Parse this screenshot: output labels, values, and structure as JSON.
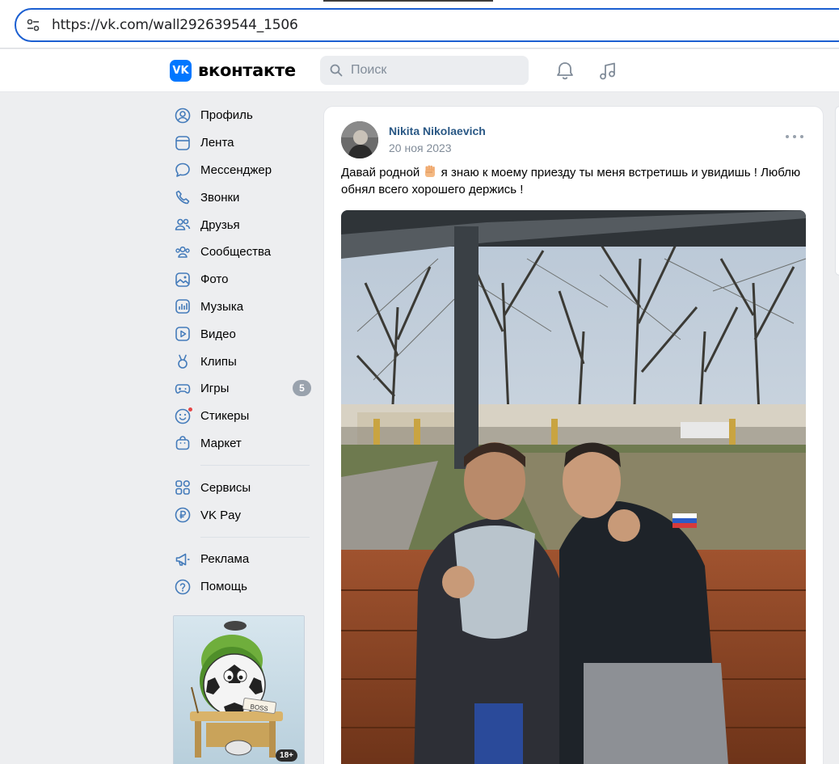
{
  "browser": {
    "url": "https://vk.com/wall292639544_1506"
  },
  "header": {
    "logo_text": "VK",
    "wordmark": "вконтакте",
    "search_placeholder": "Поиск"
  },
  "nav": {
    "items": [
      {
        "label": "Профиль",
        "icon": "profile-icon"
      },
      {
        "label": "Лента",
        "icon": "newsfeed-icon"
      },
      {
        "label": "Мессенджер",
        "icon": "messenger-icon"
      },
      {
        "label": "Звонки",
        "icon": "phone-icon"
      },
      {
        "label": "Друзья",
        "icon": "friends-icon"
      },
      {
        "label": "Сообщества",
        "icon": "communities-icon"
      },
      {
        "label": "Фото",
        "icon": "photo-icon"
      },
      {
        "label": "Музыка",
        "icon": "music-icon"
      },
      {
        "label": "Видео",
        "icon": "video-icon"
      },
      {
        "label": "Клипы",
        "icon": "clips-icon"
      },
      {
        "label": "Игры",
        "icon": "games-icon",
        "badge": "5"
      },
      {
        "label": "Стикеры",
        "icon": "stickers-icon"
      },
      {
        "label": "Маркет",
        "icon": "market-icon"
      }
    ],
    "secondary": [
      {
        "label": "Сервисы",
        "icon": "services-icon"
      },
      {
        "label": "VK Pay",
        "icon": "vkpay-icon"
      }
    ],
    "tertiary": [
      {
        "label": "Реклама",
        "icon": "ads-icon"
      },
      {
        "label": "Помощь",
        "icon": "help-icon"
      }
    ]
  },
  "ad": {
    "sign_text": "BOSS",
    "age_rating": "18+"
  },
  "post": {
    "author": "Nikita Nikolaevich",
    "date": "20 ноя 2023",
    "text_before_emoji": "Давай родной ",
    "emoji": "raised-fist-icon",
    "text_after_emoji": " я знаю к моему приезду ты меня встретишь и увидишь ! Люблю обнял всего хорошего держись !"
  },
  "colors": {
    "accent": "#0077ff",
    "link": "#2a5885",
    "icon": "#447bba",
    "background": "#edeef0"
  }
}
